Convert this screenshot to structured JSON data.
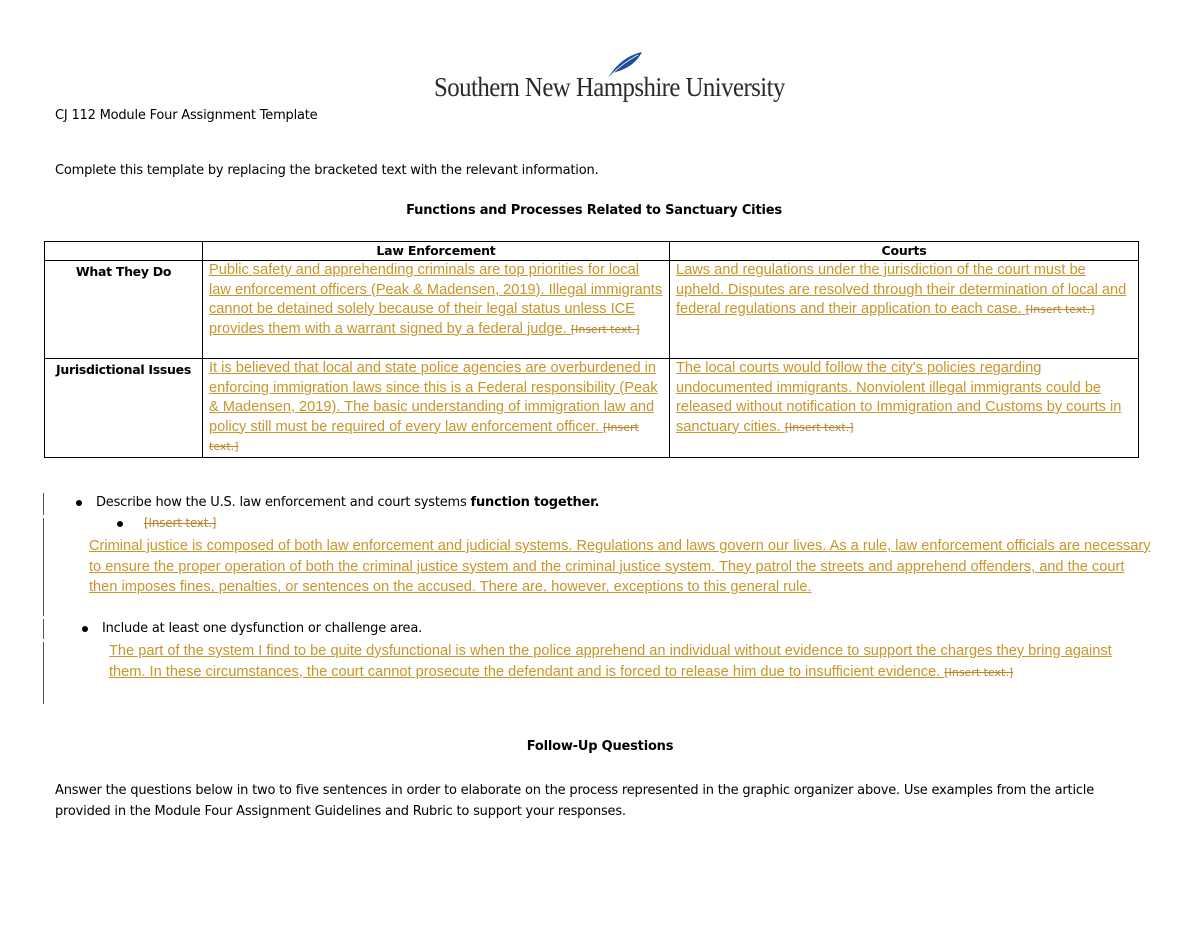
{
  "header": {
    "logo_text": "Southern New Hampshire University",
    "logo_icon": "quill-feather-icon",
    "brand_color": "#1f4e9a"
  },
  "document": {
    "title": "CJ 112 Module Four Assignment Template",
    "instructions": "Complete this template by replacing the bracketed text with the relevant information.",
    "table_heading": "Functions and Processes Related to Sanctuary Cities",
    "placeholder": "[Insert text.]",
    "track_change_color": "#c8962a"
  },
  "table": {
    "columns": [
      "",
      "Law Enforcement",
      "Courts"
    ],
    "rows": [
      {
        "label": "What They Do",
        "law_enforcement": "Public safety and apprehending criminals are top priorities for local law enforcement officers (Peak & Madensen, 2019). Illegal immigrants cannot be detained solely because of their legal status unless ICE provides them with a warrant signed by a federal judge.  ",
        "courts": "Laws and regulations under the jurisdiction of the court must be upheld.  Disputes are resolved through their determination of local and federal regulations and their application to each case. "
      },
      {
        "label": "Jurisdictional Issues",
        "law_enforcement": "It is believed that local and state police agencies are overburdened in enforcing immigration laws since this is a Federal responsibility (Peak & Madensen, 2019). The basic understanding of immigration law and policy still must be required of every law enforcement officer. ",
        "courts": "The local courts would follow the city's policies regarding undocumented immigrants.  Nonviolent illegal immigrants could be released without notification to Immigration and Customs by courts in sanctuary cities.   "
      }
    ]
  },
  "bullets": {
    "b1_prefix": "Describe how the U.S. law enforcement and court systems ",
    "b1_bold": "function together.",
    "b1_answer": "Criminal justice is composed of both law enforcement and judicial systems. Regulations and laws govern our lives. As a rule, law enforcement officials are necessary to ensure the proper operation of both the criminal justice system and the criminal justice system. They patrol the streets and apprehend offenders, and the court then imposes fines, penalties, or sentences on the accused. There are, however, exceptions to this general rule.  ",
    "b2_text": "Include at least one dysfunction or challenge area.",
    "b2_answer": "The part of the system I find to be quite dysfunctional is when the police apprehend an individual without evidence to support the charges they bring against them. In these circumstances, the court cannot prosecute the defendant and is forced to release him due to insufficient evidence.   "
  },
  "followup": {
    "heading": "Follow-Up Questions",
    "text": "Answer the questions below in two to five sentences in order to elaborate on the process represented in the graphic organizer above. Use examples from the article provided in the Module Four Assignment Guidelines and Rubric to support your responses."
  }
}
